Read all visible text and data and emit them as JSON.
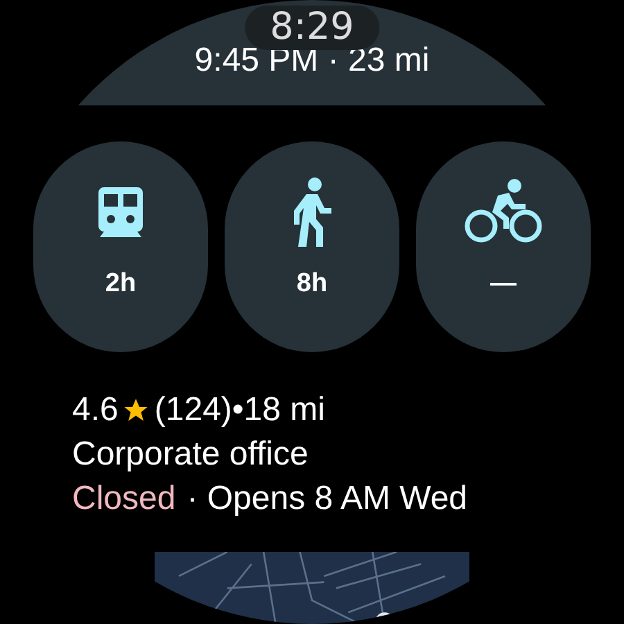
{
  "clock": "8:29",
  "route": {
    "summary": "9:45 PM · 23 mi"
  },
  "modes": [
    {
      "kind": "transit",
      "duration": "2h"
    },
    {
      "kind": "walk",
      "duration": "8h"
    },
    {
      "kind": "bike",
      "duration": "—"
    }
  ],
  "place": {
    "rating": "4.6",
    "reviews_distance": "(124)•18 mi",
    "category": "Corporate office",
    "status": "Closed",
    "open": false,
    "hours": "· Opens 8 AM Wed"
  }
}
